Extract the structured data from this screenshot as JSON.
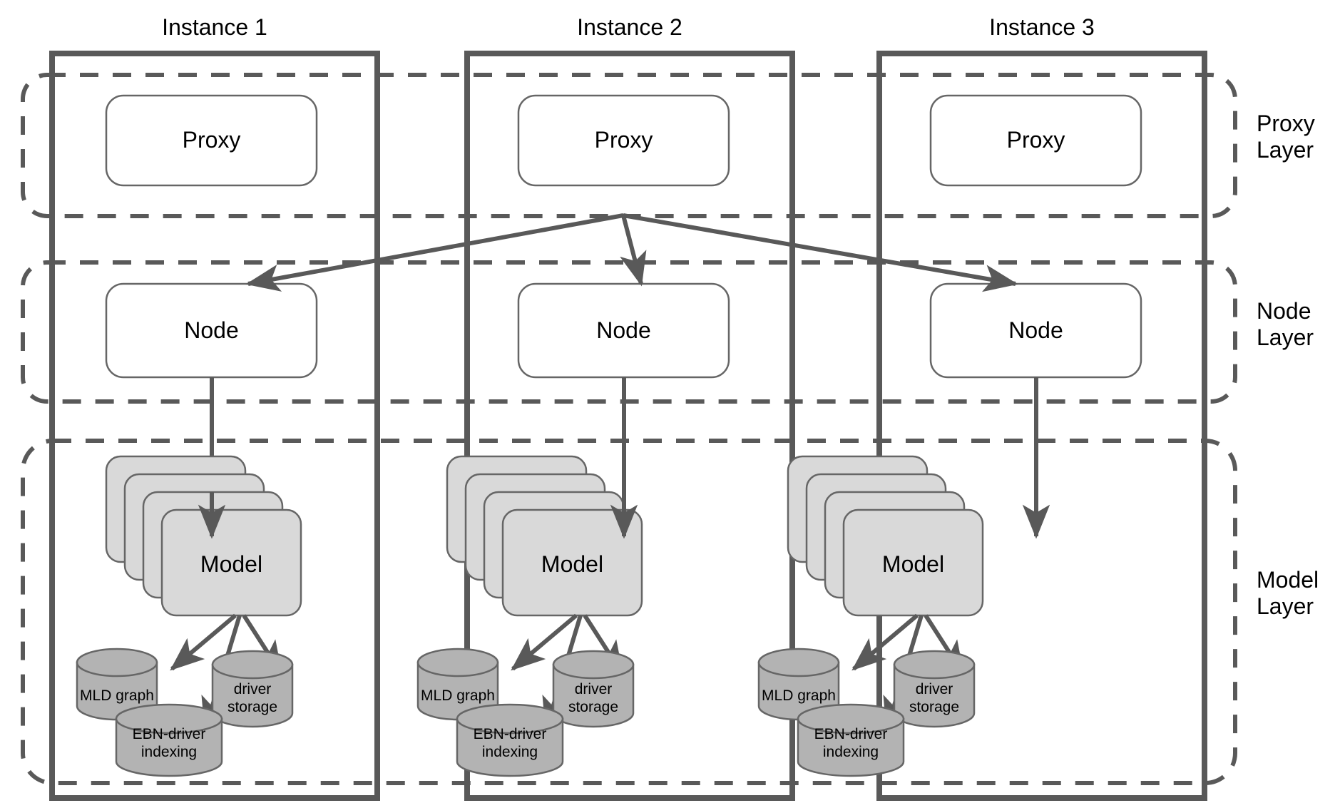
{
  "diagram": {
    "title": "Three-instance layered deployment architecture",
    "colors": {
      "instance_border": "#595959",
      "layer_dashed": "#595959",
      "plain_box_fill": "#ffffff",
      "plain_box_border": "#666666",
      "model_box_fill": "#d9d9d9",
      "model_box_border": "#666666",
      "cylinder_fill": "#b3b3b3",
      "cylinder_border": "#666666",
      "arrow": "#595959",
      "text": "#000000",
      "background": "#ffffff"
    }
  },
  "instances": [
    {
      "title": "Instance 1",
      "proxy": {
        "label": "Proxy"
      },
      "node": {
        "label": "Node"
      },
      "model": {
        "label": "Model",
        "stack_count": 4
      },
      "stores": [
        {
          "label": "MLD graph",
          "name": "mld-graph-store"
        },
        {
          "label": "driver\nstorage",
          "name": "driver-storage-store"
        },
        {
          "label": "EBN-driver\nindexing",
          "name": "ebn-driver-indexing-store"
        }
      ]
    },
    {
      "title": "Instance 2",
      "proxy": {
        "label": "Proxy"
      },
      "node": {
        "label": "Node"
      },
      "model": {
        "label": "Model",
        "stack_count": 4
      },
      "stores": [
        {
          "label": "MLD graph",
          "name": "mld-graph-store"
        },
        {
          "label": "driver\nstorage",
          "name": "driver-storage-store"
        },
        {
          "label": "EBN-driver\nindexing",
          "name": "ebn-driver-indexing-store"
        }
      ]
    },
    {
      "title": "Instance 3",
      "proxy": {
        "label": "Proxy"
      },
      "node": {
        "label": "Node"
      },
      "model": {
        "label": "Model",
        "stack_count": 4
      },
      "stores": [
        {
          "label": "MLD graph",
          "name": "mld-graph-store"
        },
        {
          "label": "driver\nstorage",
          "name": "driver-storage-store"
        },
        {
          "label": "EBN-driver\nindexing",
          "name": "ebn-driver-indexing-store"
        }
      ]
    }
  ],
  "layers": [
    {
      "label": "Proxy\nLayer",
      "name": "proxy-layer"
    },
    {
      "label": "Node\nLayer",
      "name": "node-layer"
    },
    {
      "label": "Model\nLayer",
      "name": "model-layer"
    }
  ],
  "connections": {
    "proxy2_to_nodes": [
      {
        "from": "Instance 2 Proxy",
        "to": "Instance 1 Node"
      },
      {
        "from": "Instance 2 Proxy",
        "to": "Instance 2 Node"
      },
      {
        "from": "Instance 2 Proxy",
        "to": "Instance 3 Node"
      }
    ],
    "node_to_model": [
      {
        "from": "Instance 1 Node",
        "to": "Instance 1 Model"
      },
      {
        "from": "Instance 2 Node",
        "to": "Instance 2 Model"
      },
      {
        "from": "Instance 3 Node",
        "to": "Instance 3 Model"
      }
    ],
    "model_to_stores": [
      {
        "from": "Model",
        "to": "MLD graph"
      },
      {
        "from": "Model",
        "to": "EBN-driver indexing"
      },
      {
        "from": "Model",
        "to": "driver storage"
      }
    ]
  }
}
